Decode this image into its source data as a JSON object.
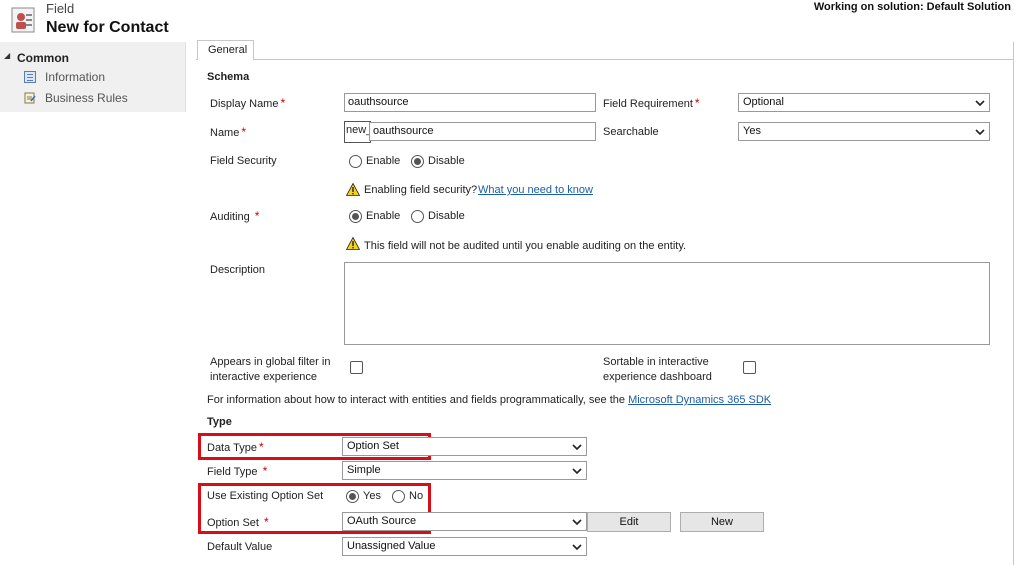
{
  "header": {
    "breadcrumb": "Field",
    "title": "New for Contact",
    "solution": "Working on solution: Default Solution"
  },
  "sidebar": {
    "section": "Common",
    "items": [
      {
        "label": "Information",
        "icon": "information-icon"
      },
      {
        "label": "Business Rules",
        "icon": "business-rules-icon"
      }
    ]
  },
  "tabs": [
    "General"
  ],
  "schema": {
    "heading": "Schema",
    "display_name": {
      "label": "Display Name",
      "value": "oauthsource"
    },
    "name": {
      "label": "Name",
      "prefix": "new_",
      "value": "oauthsource"
    },
    "field_requirement": {
      "label": "Field Requirement",
      "value": "Optional"
    },
    "searchable": {
      "label": "Searchable",
      "value": "Yes"
    },
    "field_security": {
      "label": "Field Security",
      "options": [
        "Enable",
        "Disable"
      ],
      "selected": "Disable"
    },
    "field_security_warning": "Enabling field security?",
    "field_security_link": "What you need to know",
    "auditing": {
      "label": "Auditing",
      "options": [
        "Enable",
        "Disable"
      ],
      "selected": "Enable"
    },
    "auditing_warning": "This field will not be audited until you enable auditing on the entity.",
    "description": {
      "label": "Description",
      "value": ""
    },
    "global_filter": {
      "label_line1": "Appears in global filter in",
      "label_line2": "interactive experience",
      "checked": false
    },
    "sortable": {
      "label_line1": "Sortable in interactive",
      "label_line2": "experience dashboard",
      "checked": false
    },
    "sdk_info": "For information about how to interact with entities and fields programmatically, see the",
    "sdk_link": "Microsoft Dynamics 365 SDK"
  },
  "type": {
    "heading": "Type",
    "data_type": {
      "label": "Data Type",
      "value": "Option Set"
    },
    "field_type": {
      "label": "Field Type",
      "value": "Simple"
    },
    "use_existing": {
      "label": "Use Existing Option Set",
      "options": [
        "Yes",
        "No"
      ],
      "selected": "Yes"
    },
    "option_set": {
      "label": "Option Set",
      "value": "OAuth Source"
    },
    "edit_label": "Edit",
    "new_label": "New",
    "default_value": {
      "label": "Default Value",
      "value": "Unassigned Value"
    }
  },
  "colors": {
    "highlight": "#d90d18",
    "link": "#1a5ea8",
    "required": "#cc0000"
  }
}
